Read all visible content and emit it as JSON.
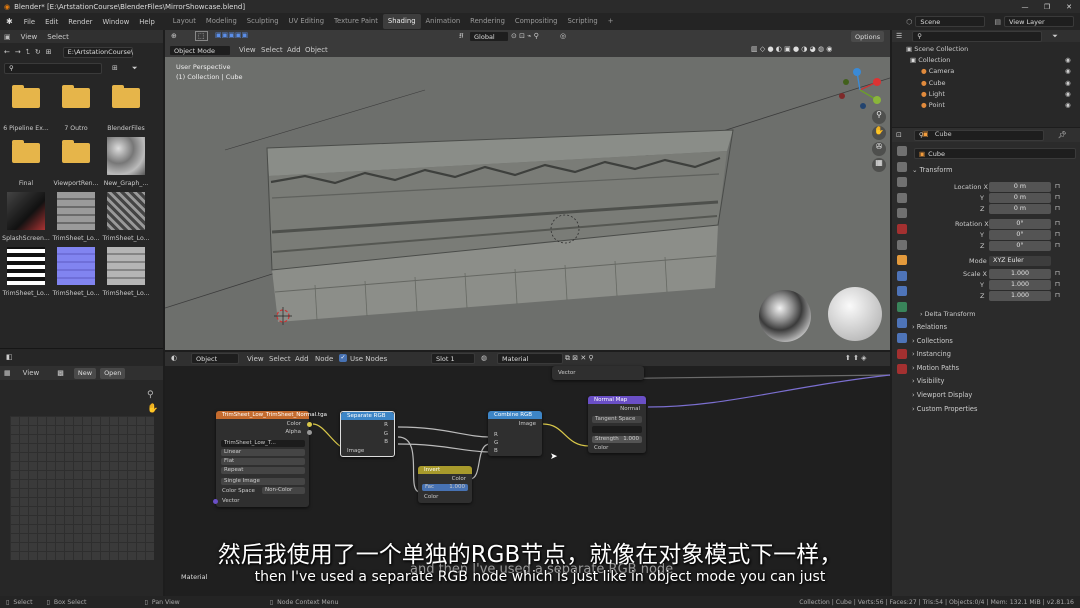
{
  "window": {
    "title": "Blender* [E:\\ArtstationCourse\\BlenderFiles\\MirrorShowcase.blend]",
    "minimize": "—",
    "maximize": "❐",
    "close": "✕"
  },
  "menu": [
    "File",
    "Edit",
    "Render",
    "Window",
    "Help"
  ],
  "workspaces": [
    "Layout",
    "Modeling",
    "Sculpting",
    "UV Editing",
    "Texture Paint",
    "Shading",
    "Animation",
    "Rendering",
    "Compositing",
    "Scripting"
  ],
  "active_workspace": "Shading",
  "add_workspace": "+",
  "scene": "Scene",
  "view_layer": "View Layer",
  "file_browser": {
    "view": "View",
    "select": "Select",
    "path": "E:\\ArtstationCourse\\",
    "items": [
      {
        "label": "6 Pipeline Ex...",
        "kind": "folder"
      },
      {
        "label": "7 Outro",
        "kind": "folder"
      },
      {
        "label": "BlenderFiles",
        "kind": "folder"
      },
      {
        "label": "Final",
        "kind": "folder"
      },
      {
        "label": "ViewportRen...",
        "kind": "folder"
      },
      {
        "label": "New_Graph_...",
        "kind": "noise"
      },
      {
        "label": "SplashScreen...",
        "kind": "dark"
      },
      {
        "label": "TrimSheet_Lo...",
        "kind": "gray"
      },
      {
        "label": "TrimSheet_Lo...",
        "kind": "zig"
      },
      {
        "label": "TrimSheet_Lo...",
        "kind": "stripes"
      },
      {
        "label": "TrimSheet_Lo...",
        "kind": "blue"
      },
      {
        "label": "TrimSheet_Lo...",
        "kind": "gray2"
      }
    ]
  },
  "image_editor": {
    "view": "View",
    "new": "New",
    "open": "Open"
  },
  "viewport": {
    "mode": "Object Mode",
    "view": "View",
    "select": "Select",
    "add": "Add",
    "object": "Object",
    "transform": "Global",
    "options": "Options",
    "info_line1": "User Perspective",
    "info_line2": "(1) Collection | Cube"
  },
  "node_editor": {
    "type": "Object",
    "view": "View",
    "select": "Select",
    "add": "Add",
    "node": "Node",
    "use_nodes": "Use Nodes",
    "slot": "Slot 1",
    "material": "Material",
    "footer_label": "Material",
    "nodes": {
      "image": {
        "title": "TrimSheet_Low_TrimSheet_Normal.tga",
        "out_color": "Color",
        "out_alpha": "Alpha",
        "file": "TrimSheet_Low_T...",
        "interp": "Linear",
        "proj": "Flat",
        "ext": "Repeat",
        "source": "Single Image",
        "cs_label": "Color Space",
        "cs_value": "Non-Color",
        "vector": "Vector"
      },
      "separate": {
        "title": "Separate RGB",
        "r": "R",
        "g": "G",
        "b": "B",
        "in": "Image"
      },
      "combine": {
        "title": "Combine RGB",
        "out": "Image",
        "r": "R",
        "g": "G",
        "b": "B"
      },
      "invert": {
        "title": "Invert",
        "color_out": "Color",
        "fac_label": "Fac",
        "fac_value": "1.000",
        "color_in": "Color"
      },
      "normal": {
        "title": "Normal Map",
        "out": "Normal",
        "space": "Tangent Space",
        "uv": "",
        "strength_label": "Strength",
        "strength_value": "1.000",
        "color": "Color"
      },
      "vector_stub": "Vector"
    }
  },
  "outliner": {
    "scene_collection": "Scene Collection",
    "items": [
      {
        "label": "Collection",
        "indent": 0,
        "icon": "collection"
      },
      {
        "label": "Camera",
        "indent": 1,
        "icon": "camera"
      },
      {
        "label": "Cube",
        "indent": 1,
        "icon": "mesh"
      },
      {
        "label": "Light",
        "indent": 1,
        "icon": "light"
      },
      {
        "label": "Point",
        "indent": 1,
        "icon": "point"
      }
    ]
  },
  "properties": {
    "object_name": "Cube",
    "data_name": "Cube",
    "transform": "Transform",
    "location": {
      "label": "Location X",
      "x": "0 m",
      "y": "0 m",
      "z": "0 m"
    },
    "rotation": {
      "label": "Rotation X",
      "x": "0°",
      "y": "0°",
      "z": "0°"
    },
    "mode_label": "Mode",
    "mode_value": "XYZ Euler",
    "scale": {
      "label": "Scale X",
      "x": "1.000",
      "y": "1.000",
      "z": "1.000"
    },
    "axis_y": "Y",
    "axis_z": "Z",
    "delta": "Delta Transform",
    "sections": [
      "Relations",
      "Collections",
      "Instancing",
      "Motion Paths",
      "Visibility",
      "Viewport Display",
      "Custom Properties"
    ]
  },
  "subtitle": {
    "zh": "然后我使用了一个单独的RGB节点，就像在对象模式下一样，",
    "en": "then I've used a separate RGB node which is just like in object mode you can just",
    "ghost": "and then I've used a separate RGB node"
  },
  "status": {
    "select": "Select",
    "box_select": "Box Select",
    "pan_view": "Pan View",
    "node_context": "Node Context Menu",
    "stats": "Collection | Cube | Verts:56 | Faces:27 | Tris:54 | Objects:0/4 | Mem: 132.1 MiB | v2.81.16"
  },
  "colors": {
    "accent": "#4772b3",
    "image_node": "#c46b2e",
    "converter_node": "#3d85c6",
    "color_node": "#a89a2c",
    "vector_node": "#6a4fc6"
  }
}
